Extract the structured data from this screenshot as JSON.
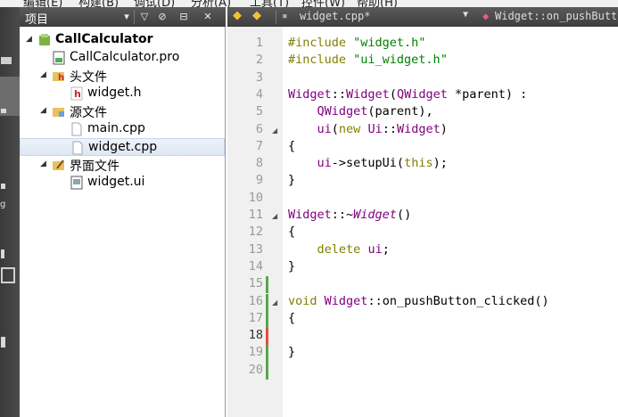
{
  "menubar": {
    "items": [
      "构建(B)",
      "调试(D)",
      "分析(A)",
      "工具(T)",
      "控件(W)",
      "帮助(H)"
    ],
    "partial_items": [
      "编辑(E)"
    ]
  },
  "modebar": {
    "labels": [
      "g"
    ]
  },
  "project_panel": {
    "title": "项目",
    "tree": [
      {
        "label": "CallCalculator",
        "bold": true,
        "level": 0,
        "expanded": true,
        "icon": "project-icon"
      },
      {
        "label": "CallCalculator.pro",
        "level": 1,
        "icon": "pro-file-icon"
      },
      {
        "label": "头文件",
        "level": 1,
        "expanded": true,
        "icon": "header-folder-icon"
      },
      {
        "label": "widget.h",
        "level": 2,
        "icon": "header-file-icon"
      },
      {
        "label": "源文件",
        "level": 1,
        "expanded": true,
        "icon": "source-folder-icon"
      },
      {
        "label": "main.cpp",
        "level": 2,
        "icon": "source-file-icon"
      },
      {
        "label": "widget.cpp",
        "level": 2,
        "icon": "source-file-icon",
        "selected": true
      },
      {
        "label": "界面文件",
        "level": 1,
        "expanded": true,
        "icon": "forms-folder-icon"
      },
      {
        "label": "widget.ui",
        "level": 2,
        "icon": "ui-file-icon"
      }
    ]
  },
  "editor": {
    "file": "widget.cpp*",
    "symbol": "Widget::on_pushButton_clicked()",
    "current_line": 18,
    "lines": [
      {
        "n": "1",
        "tokens": [
          [
            "kw",
            "#include "
          ],
          [
            "str",
            "\"widget.h\""
          ]
        ]
      },
      {
        "n": "2",
        "tokens": [
          [
            "kw",
            "#include "
          ],
          [
            "str",
            "\"ui_widget.h\""
          ]
        ]
      },
      {
        "n": "3",
        "tokens": []
      },
      {
        "n": "4",
        "tokens": [
          [
            "typ",
            "Widget"
          ],
          [
            "",
            "::"
          ],
          [
            "typ",
            "Widget"
          ],
          [
            "",
            "("
          ],
          [
            "typ",
            "QWidget"
          ],
          [
            "",
            " *parent) :"
          ]
        ]
      },
      {
        "n": "5",
        "tokens": [
          [
            "",
            "    "
          ],
          [
            "typ",
            "QWidget"
          ],
          [
            "",
            "(parent),"
          ]
        ]
      },
      {
        "n": "6",
        "tokens": [
          [
            "",
            "    "
          ],
          [
            "typ",
            "ui"
          ],
          [
            "",
            "("
          ],
          [
            "kw",
            "new"
          ],
          [
            "",
            " "
          ],
          [
            "typ",
            "Ui"
          ],
          [
            "",
            "::"
          ],
          [
            "typ",
            "Widget"
          ],
          [
            "",
            ")"
          ]
        ],
        "fold": true
      },
      {
        "n": "7",
        "tokens": [
          [
            "",
            "{"
          ]
        ]
      },
      {
        "n": "8",
        "tokens": [
          [
            "",
            "    "
          ],
          [
            "typ",
            "ui"
          ],
          [
            "",
            "->setupUi("
          ],
          [
            "kw",
            "this"
          ],
          [
            "",
            ");"
          ]
        ]
      },
      {
        "n": "9",
        "tokens": [
          [
            "",
            "}"
          ]
        ]
      },
      {
        "n": "10",
        "tokens": []
      },
      {
        "n": "11",
        "tokens": [
          [
            "typ",
            "Widget"
          ],
          [
            "",
            "::~"
          ],
          [
            "typ it",
            "Widget"
          ],
          [
            "",
            "()"
          ]
        ],
        "fold": true
      },
      {
        "n": "12",
        "tokens": [
          [
            "",
            "{"
          ]
        ]
      },
      {
        "n": "13",
        "tokens": [
          [
            "",
            "    "
          ],
          [
            "kw",
            "delete"
          ],
          [
            "",
            " "
          ],
          [
            "typ",
            "ui"
          ],
          [
            "",
            ";"
          ]
        ]
      },
      {
        "n": "14",
        "tokens": [
          [
            "",
            "}"
          ]
        ]
      },
      {
        "n": "15",
        "tokens": [],
        "mark": "green"
      },
      {
        "n": "16",
        "tokens": [
          [
            "kw",
            "void"
          ],
          [
            "",
            " "
          ],
          [
            "typ",
            "Widget"
          ],
          [
            "",
            "::on_pushButton_clicked()"
          ]
        ],
        "fold": true,
        "mark": "green"
      },
      {
        "n": "17",
        "tokens": [
          [
            "",
            "{"
          ]
        ],
        "mark": "green"
      },
      {
        "n": "18",
        "tokens": [],
        "mark": "red"
      },
      {
        "n": "19",
        "tokens": [
          [
            "",
            "}"
          ]
        ],
        "mark": "green"
      },
      {
        "n": "20",
        "tokens": [],
        "mark": "green"
      }
    ]
  },
  "colors": {
    "keyword": "#808000",
    "string": "#008000",
    "type": "#800080",
    "mark_green": "#57a64a",
    "mark_red": "#e0503c"
  }
}
